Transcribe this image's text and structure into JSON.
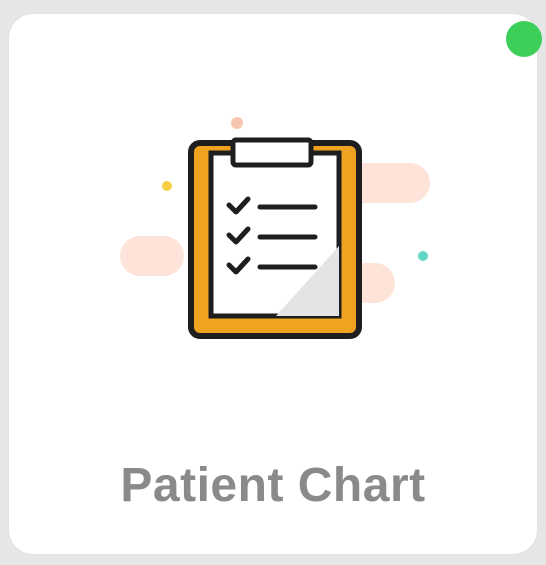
{
  "tile": {
    "label": "Patient Chart",
    "icon": "clipboard-checklist-icon",
    "status": "online",
    "status_color": "#3ecf5a",
    "accent_color": "#f0a321"
  }
}
